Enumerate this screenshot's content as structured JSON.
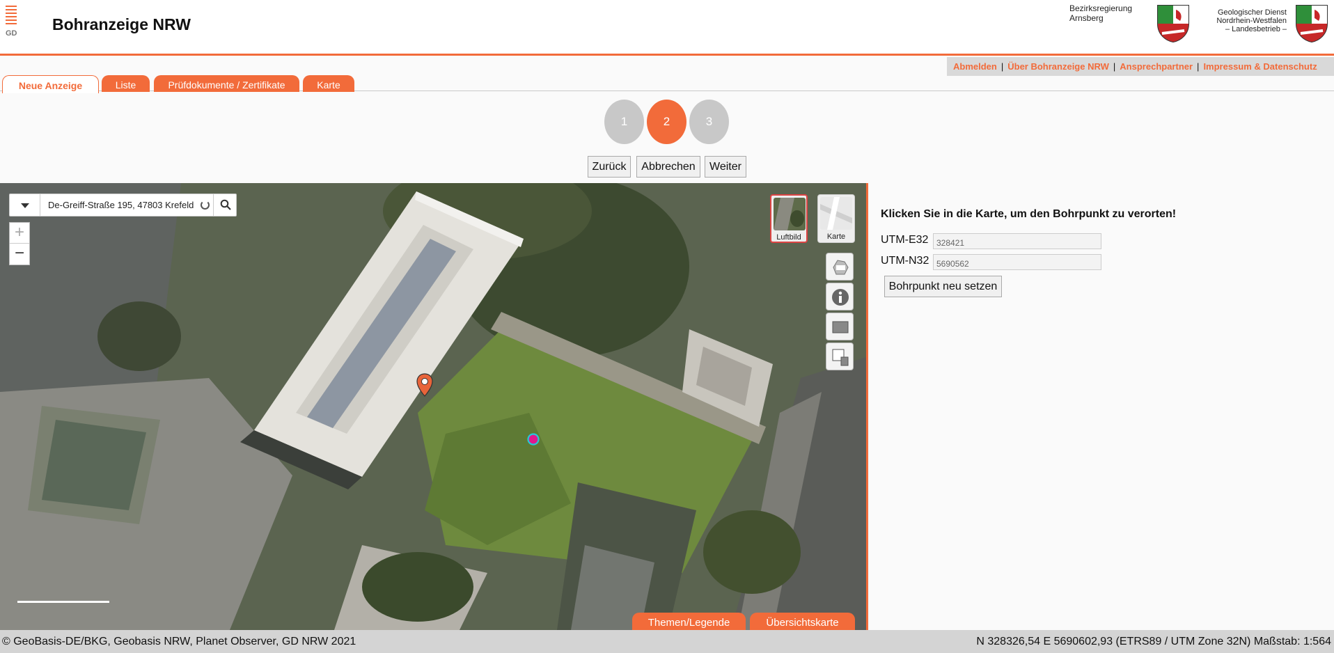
{
  "header": {
    "gd_logo_text": "GD",
    "title": "Bohranzeige NRW",
    "brand1": [
      "Bezirksregierung",
      "Arnsberg"
    ],
    "brand2": [
      "Geologischer Dienst",
      "Nordrhein-Westfalen",
      "– Landesbetrieb –"
    ]
  },
  "meta_nav": {
    "links": [
      "Abmelden",
      "Über Bohranzeige NRW",
      "Ansprechpartner",
      "Impressum & Datenschutz"
    ],
    "separator": "|"
  },
  "tabs": [
    {
      "label": "Neue Anzeige",
      "active": true
    },
    {
      "label": "Liste",
      "active": false
    },
    {
      "label": "Prüfdokumente / Zertifikate",
      "active": false
    },
    {
      "label": "Karte",
      "active": false
    }
  ],
  "steps": [
    {
      "label": "1",
      "active": false
    },
    {
      "label": "2",
      "active": true
    },
    {
      "label": "3",
      "active": false
    }
  ],
  "nav_buttons": {
    "back": "Zurück",
    "cancel": "Abbrechen",
    "next": "Weiter"
  },
  "map": {
    "search_value": "De-Greiff-Straße 195, 47803 Krefeld",
    "zoom_in": "+",
    "zoom_out": "−",
    "basemaps": [
      {
        "label": "Luftbild",
        "selected": true
      },
      {
        "label": "Karte",
        "selected": false
      }
    ],
    "tools": [
      "nrw-overview-icon",
      "info-icon",
      "layer-icon",
      "print-icon"
    ],
    "bottom_tabs": [
      "Themen/Legende",
      "Übersichtskarte"
    ],
    "colors": {
      "accent": "#f26b3a",
      "marker": "#e8643a",
      "point": "#e0188c",
      "point_ring": "#27c8d8"
    }
  },
  "panel": {
    "title": "Klicken Sie in die Karte, um den Bohrpunkt zu verorten!",
    "e_label": "UTM-E32",
    "e_value": "328421",
    "n_label": "UTM-N32",
    "n_value": "5690562",
    "reset_button": "Bohrpunkt neu setzen"
  },
  "footer": {
    "attribution": "© GeoBasis-DE/BKG, Geobasis NRW, Planet Observer, GD NRW 2021",
    "coords": "N 328326,54 E  5690602,93 (ETRS89 / UTM Zone 32N) Maßstab: 1:564"
  }
}
